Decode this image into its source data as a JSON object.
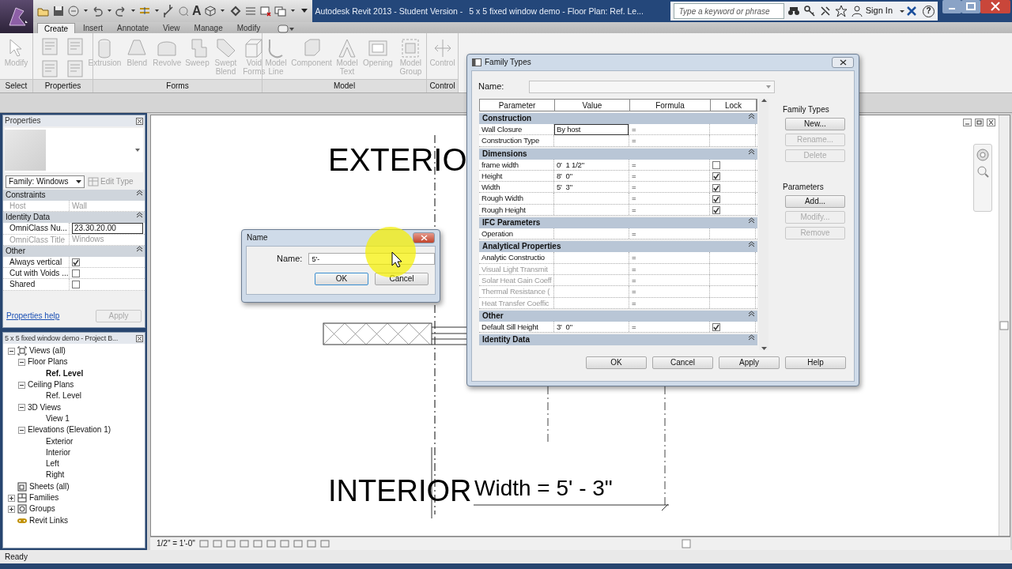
{
  "title_bar": {
    "text_tool": "A",
    "app_title": "Autodesk Revit 2013 - Student Version -",
    "document_title": "5 x 5 fixed window demo - Floor Plan: Ref. Le...",
    "search_placeholder": "Type a keyword or phrase",
    "sign_in": "Sign In",
    "help": "?"
  },
  "ribbon": {
    "tabs": [
      {
        "label": "Create",
        "selected": true
      },
      {
        "label": "Insert",
        "selected": false
      },
      {
        "label": "Annotate",
        "selected": false
      },
      {
        "label": "View",
        "selected": false
      },
      {
        "label": "Manage",
        "selected": false
      },
      {
        "label": "Modify",
        "selected": false
      }
    ],
    "panels": [
      {
        "label": "Select",
        "buttons": [
          {
            "label": "Modify",
            "disabled": true
          }
        ]
      },
      {
        "label": "Properties"
      },
      {
        "label": "Forms",
        "buttons": [
          {
            "label": "Extrusion",
            "disabled": true
          },
          {
            "label": "Blend",
            "disabled": true
          },
          {
            "label": "Revolve",
            "disabled": true
          },
          {
            "label": "Sweep",
            "disabled": true
          },
          {
            "label": "Swept Blend",
            "disabled": true
          },
          {
            "label": "Void Forms",
            "disabled": true
          }
        ]
      },
      {
        "label": "Model",
        "buttons": [
          {
            "label": "Model Line",
            "disabled": true
          },
          {
            "label": "Component",
            "disabled": true
          },
          {
            "label": "Model Text",
            "disabled": true
          },
          {
            "label": "Opening",
            "disabled": true
          },
          {
            "label": "Model Group",
            "disabled": true
          }
        ]
      },
      {
        "label": "Control",
        "buttons": [
          {
            "label": "Control",
            "disabled": true
          }
        ]
      }
    ]
  },
  "properties": {
    "title": "Properties",
    "type_selector": "Family: Windows",
    "edit_type": {
      "label": "Edit Type",
      "disabled": true
    },
    "groups": [
      {
        "label": "Constraints",
        "rows": [
          {
            "label": "Host",
            "value": "Wall",
            "kind": "text",
            "disabled": true
          }
        ]
      },
      {
        "label": "Identity Data",
        "rows": [
          {
            "label": "OmniClass Nu...",
            "value": "23.30.20.00",
            "kind": "field",
            "disabled": false
          },
          {
            "label": "OmniClass Title",
            "value": "Windows",
            "kind": "text",
            "disabled": true
          }
        ]
      },
      {
        "label": "Other",
        "rows": [
          {
            "label": "Always vertical",
            "kind": "check",
            "checked": true,
            "disabled": false
          },
          {
            "label": "Cut with Voids ...",
            "kind": "check",
            "checked": false,
            "disabled": false
          },
          {
            "label": "Shared",
            "kind": "check",
            "checked": false,
            "disabled": false
          }
        ]
      }
    ],
    "help_link": "Properties help",
    "apply": {
      "label": "Apply",
      "disabled": true
    }
  },
  "project_browser": {
    "title": "5 x 5 fixed window demo - Project B...",
    "tree": [
      {
        "label": "Views (all)",
        "expanded": true,
        "selected": false,
        "children": [
          {
            "label": "Floor Plans",
            "expanded": true,
            "selected": false,
            "children": [
              {
                "label": "Ref. Level",
                "selected": true
              }
            ]
          },
          {
            "label": "Ceiling Plans",
            "expanded": true,
            "selected": false,
            "children": [
              {
                "label": "Ref. Level",
                "selected": false
              }
            ]
          },
          {
            "label": "3D Views",
            "expanded": true,
            "selected": false,
            "children": [
              {
                "label": "View 1",
                "selected": false
              }
            ]
          },
          {
            "label": "Elevations (Elevation 1)",
            "expanded": true,
            "selected": false,
            "children": [
              {
                "label": "Exterior",
                "selected": false
              },
              {
                "label": "Interior",
                "selected": false
              },
              {
                "label": "Left",
                "selected": false
              },
              {
                "label": "Right",
                "selected": false
              }
            ]
          }
        ]
      },
      {
        "label": "Sheets (all)",
        "selected": false
      },
      {
        "label": "Families",
        "expanded": false,
        "selected": false
      },
      {
        "label": "Groups",
        "expanded": false,
        "selected": false
      },
      {
        "label": "Revit Links",
        "selected": false
      }
    ]
  },
  "canvas": {
    "exterior_label": "EXTERIO",
    "interior_label": "INTERIOR",
    "dimension_label": "Width = 5' - 3\""
  },
  "view_bar": {
    "scale": "1/2\" = 1'-0\""
  },
  "status_bar": {
    "text": "Ready"
  },
  "family_types": {
    "title": "Family Types",
    "name_label": "Name:",
    "columns": [
      "Parameter",
      "Value",
      "Formula",
      "Lock"
    ],
    "groups": [
      {
        "label": "Construction",
        "rows": [
          {
            "parameter": "Wall Closure",
            "value": "By host",
            "kind": "field",
            "formula": "=",
            "disabled": false
          },
          {
            "parameter": "Construction Type",
            "formula": "=",
            "disabled": false
          }
        ]
      },
      {
        "label": "Dimensions",
        "rows": [
          {
            "parameter": "frame width",
            "value": "0'  1 1/2\"",
            "kind": "text",
            "formula": "=",
            "locked": false,
            "disabled": false
          },
          {
            "parameter": "Height",
            "value": "8'  0\"",
            "kind": "text",
            "formula": "=",
            "locked": true,
            "disabled": false
          },
          {
            "parameter": "Width",
            "value": "5'  3\"",
            "kind": "text",
            "formula": "=",
            "locked": true,
            "disabled": false
          },
          {
            "parameter": "Rough Width",
            "formula": "=",
            "locked": true,
            "disabled": false
          },
          {
            "parameter": "Rough Height",
            "formula": "=",
            "locked": true,
            "disabled": false
          }
        ]
      },
      {
        "label": "IFC Parameters",
        "rows": [
          {
            "parameter": "Operation",
            "formula": "=",
            "disabled": false
          }
        ]
      },
      {
        "label": "Analytical Properties",
        "rows": [
          {
            "parameter": "Analytic Constructio",
            "formula": "=",
            "disabled": false
          },
          {
            "parameter": "Visual Light Transmit",
            "formula": "=",
            "disabled": true
          },
          {
            "parameter": "Solar Heat Gain Coeff",
            "formula": "=",
            "disabled": true
          },
          {
            "parameter": "Thermal Resistance (",
            "formula": "=",
            "disabled": true
          },
          {
            "parameter": "Heat Transfer Coeffic",
            "formula": "=",
            "disabled": true
          }
        ]
      },
      {
        "label": "Other",
        "rows": [
          {
            "parameter": "Default Sill Height",
            "value": "3'  0\"",
            "kind": "text",
            "formula": "=",
            "locked": true,
            "disabled": false
          }
        ]
      },
      {
        "label": "Identity Data"
      }
    ],
    "side_sections": [
      {
        "label": "Family Types",
        "buttons": [
          {
            "label": "New...",
            "disabled": false
          },
          {
            "label": "Rename...",
            "disabled": true
          },
          {
            "label": "Delete",
            "disabled": true
          }
        ]
      },
      {
        "label": "Parameters",
        "buttons": [
          {
            "label": "Add...",
            "disabled": false
          },
          {
            "label": "Modify...",
            "disabled": true
          },
          {
            "label": "Remove",
            "disabled": true
          }
        ]
      }
    ],
    "buttons": [
      "OK",
      "Cancel",
      "Apply",
      "Help"
    ]
  },
  "name_dialog": {
    "title": "Name",
    "label": "Name:",
    "value": "5'-",
    "buttons": [
      "OK",
      "Cancel"
    ]
  }
}
